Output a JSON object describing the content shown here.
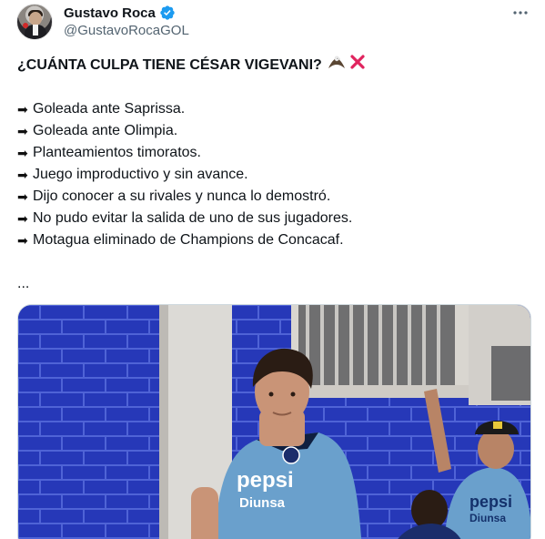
{
  "author": {
    "display_name": "Gustavo Roca",
    "handle": "@GustavoRocaGOL",
    "verified": true
  },
  "tweet": {
    "headline": "¿CUÁNTA CULPA TIENE CÉSAR VIGEVANI?",
    "headline_emojis": [
      "eagle-icon",
      "red-x-icon"
    ],
    "bullet_icon": "right-arrow-icon",
    "bullets": [
      "Goleada ante Saprissa.",
      "Goleada ante Olimpia.",
      "Planteamientos timoratos.",
      "Juego improductivo y sin avance.",
      "Dijo conocer a su rivales y nunca lo demostró.",
      "No pudo evitar la salida de uno de sus jugadores.",
      "Motagua eliminado de Champions de Concacaf."
    ],
    "ellipsis": "..."
  },
  "media": {
    "jersey_text_main": "pepsi",
    "jersey_text_sub": "Diunsa",
    "background_jersey_main": "pepsi",
    "background_jersey_sub": "Diunsa"
  },
  "colors": {
    "text": "#0f1419",
    "secondary": "#536471",
    "verified_blue": "#1d9bf0",
    "wall_blue": "#2638b8",
    "jersey_blue": "#6aa0cc",
    "red_x": "#e0245e"
  }
}
